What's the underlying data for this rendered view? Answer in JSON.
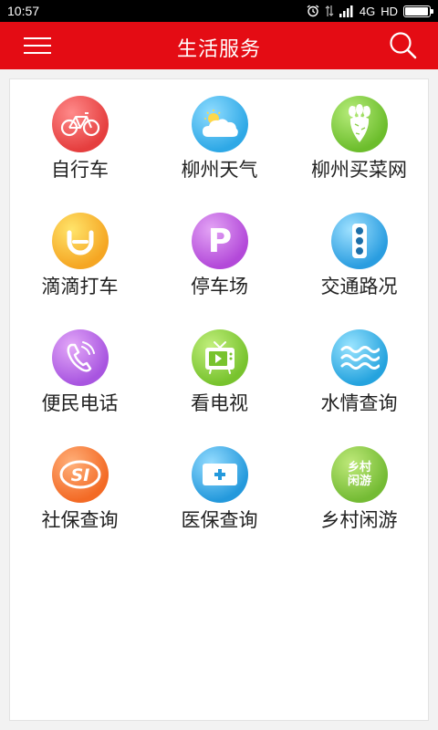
{
  "status_bar": {
    "time": "10:57",
    "network": "4G",
    "hd": "HD",
    "battery_level": 0.95
  },
  "header": {
    "title": "生活服务",
    "menu_icon": "menu-icon",
    "search_icon": "search-icon",
    "color": "#e40c14"
  },
  "services": [
    {
      "label": "自行车",
      "icon": "bicycle-icon"
    },
    {
      "label": "柳州天气",
      "icon": "weather-icon"
    },
    {
      "label": "柳州买菜网",
      "icon": "vegetable-icon"
    },
    {
      "label": "滴滴打车",
      "icon": "didi-icon"
    },
    {
      "label": "停车场",
      "icon": "parking-icon",
      "icon_text": "P"
    },
    {
      "label": "交通路况",
      "icon": "traffic-light-icon"
    },
    {
      "label": "便民电话",
      "icon": "phone-icon"
    },
    {
      "label": "看电视",
      "icon": "tv-icon"
    },
    {
      "label": "水情查询",
      "icon": "water-icon"
    },
    {
      "label": "社保查询",
      "icon": "social-security-icon",
      "icon_text": "SI"
    },
    {
      "label": "医保查询",
      "icon": "medical-insurance-icon"
    },
    {
      "label": "乡村闲游",
      "icon": "village-tour-icon",
      "icon_text": "乡村闲游"
    }
  ]
}
